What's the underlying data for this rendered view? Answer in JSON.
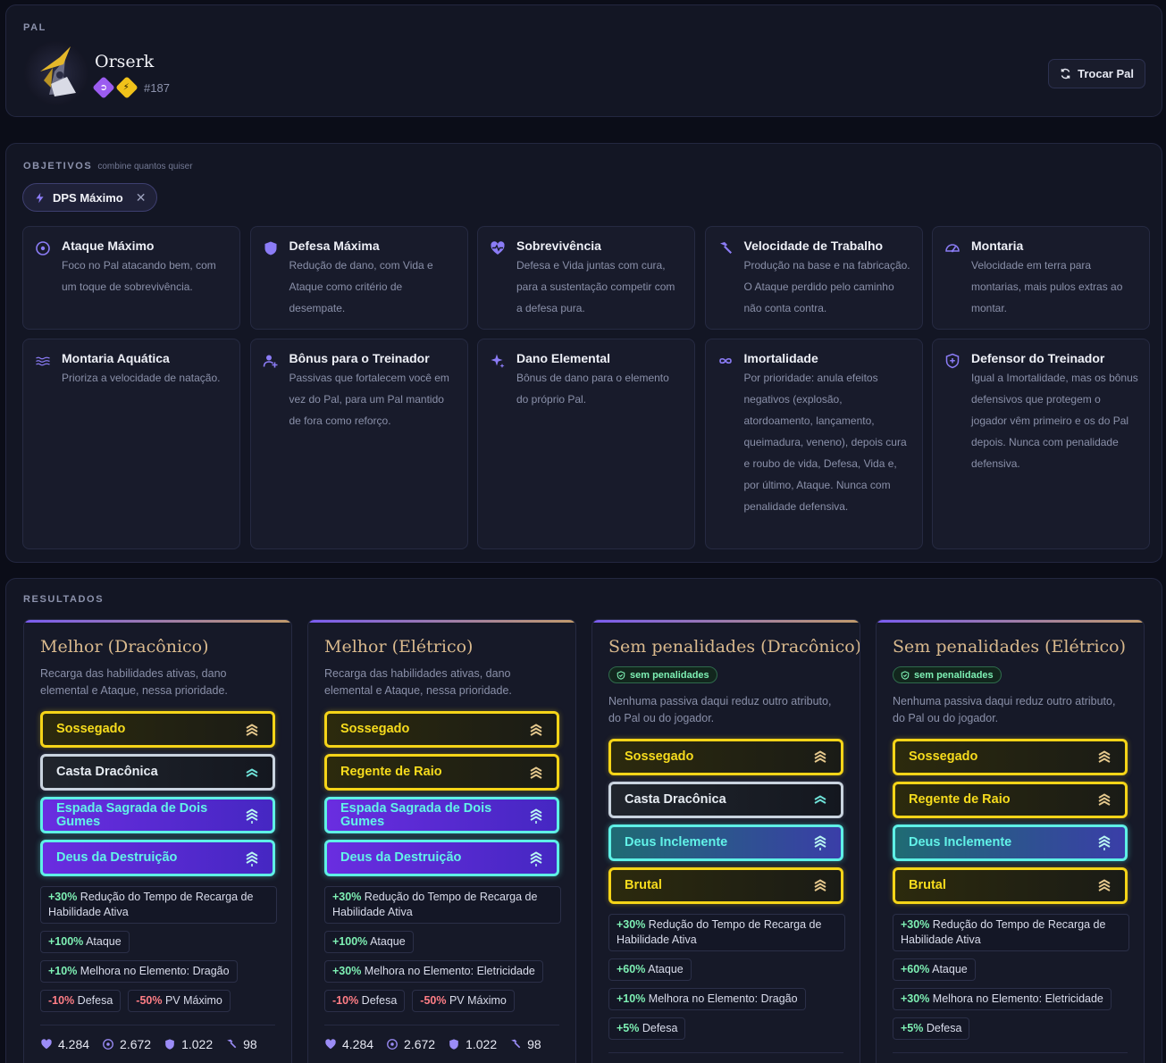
{
  "pal": {
    "section_label": "PAL",
    "name": "Orserk",
    "number": "#187",
    "swap_label": "Trocar Pal"
  },
  "objectives": {
    "section_label": "OBJETIVOS",
    "section_sub": "combine quantos quiser",
    "selected_chip": "DPS Máximo",
    "items": [
      {
        "title": "Ataque Máximo",
        "desc": "Foco no Pal atacando bem, com um toque de sobrevivência.",
        "icon": "target-icon"
      },
      {
        "title": "Defesa Máxima",
        "desc": "Redução de dano, com Vida e Ataque como critério de desempate.",
        "icon": "shield-icon"
      },
      {
        "title": "Sobrevivência",
        "desc": "Defesa e Vida juntas com cura, para a sustentação competir com a defesa pura.",
        "icon": "heart-pulse-icon"
      },
      {
        "title": "Velocidade de Trabalho",
        "desc": "Produção na base e na fabricação. O Ataque perdido pelo caminho não conta contra.",
        "icon": "hammer-icon"
      },
      {
        "title": "Montaria",
        "desc": "Velocidade em terra para montarias, mais pulos extras ao montar.",
        "icon": "gauge-icon"
      },
      {
        "title": "Montaria Aquática",
        "desc": "Prioriza a velocidade de natação.",
        "icon": "waves-icon"
      },
      {
        "title": "Bônus para o Treinador",
        "desc": "Passivas que fortalecem você em vez do Pal, para um Pal mantido de fora como reforço.",
        "icon": "user-plus-icon"
      },
      {
        "title": "Dano Elemental",
        "desc": "Bônus de dano para o elemento do próprio Pal.",
        "icon": "sparkles-icon"
      },
      {
        "title": "Imortalidade",
        "desc": "Por prioridade: anula efeitos negativos (explosão, atordoamento, lançamento, queimadura, veneno), depois cura e roubo de vida, Defesa, Vida e, por último, Ataque. Nunca com penalidade defensiva.",
        "icon": "infinity-icon"
      },
      {
        "title": "Defensor do Treinador",
        "desc": "Igual a Imortalidade, mas os bônus defensivos que protegem o jogador vêm primeiro e os do Pal depois. Nunca com penalidade defensiva.",
        "icon": "shield-plus-icon"
      }
    ]
  },
  "results": {
    "section_label": "RESULTADOS",
    "no_penalty_label": "sem penalidades",
    "cards": [
      {
        "title": "Melhor (Dracônico)",
        "no_penalty": false,
        "desc": "Recarga das habilidades ativas, dano elemental e Ataque, nessa prioridade.",
        "passives": [
          {
            "name": "Sossegado",
            "tier": "gold"
          },
          {
            "name": "Casta Dracônica",
            "tier": "silver"
          },
          {
            "name": "Espada Sagrada de Dois Gumes",
            "tier": "purple"
          },
          {
            "name": "Deus da Destruição",
            "tier": "purple"
          }
        ],
        "effects": [
          {
            "val": "+30%",
            "label": " Redução do Tempo de Recarga de Habilidade Ativa",
            "neg": false,
            "wide": true
          },
          {
            "val": "+100%",
            "label": " Ataque",
            "neg": false,
            "wide": false
          },
          {
            "val": "+10%",
            "label": " Melhora no Elemento: Dragão",
            "neg": false,
            "wide": false
          },
          {
            "val": "-10%",
            "label": " Defesa",
            "neg": true,
            "wide": false
          },
          {
            "val": "-50%",
            "label": " PV Máximo",
            "neg": true,
            "wide": false
          }
        ],
        "stats": {
          "hp": "4.284",
          "atk": "2.672",
          "def": "1.022",
          "work": "98"
        }
      },
      {
        "title": "Melhor (Elétrico)",
        "no_penalty": false,
        "desc": "Recarga das habilidades ativas, dano elemental e Ataque, nessa prioridade.",
        "passives": [
          {
            "name": "Sossegado",
            "tier": "gold"
          },
          {
            "name": "Regente de Raio",
            "tier": "gold"
          },
          {
            "name": "Espada Sagrada de Dois Gumes",
            "tier": "purple"
          },
          {
            "name": "Deus da Destruição",
            "tier": "purple"
          }
        ],
        "effects": [
          {
            "val": "+30%",
            "label": " Redução do Tempo de Recarga de Habilidade Ativa",
            "neg": false,
            "wide": true
          },
          {
            "val": "+100%",
            "label": " Ataque",
            "neg": false,
            "wide": false
          },
          {
            "val": "+30%",
            "label": " Melhora no Elemento: Eletricidade",
            "neg": false,
            "wide": false
          },
          {
            "val": "-10%",
            "label": " Defesa",
            "neg": true,
            "wide": false
          },
          {
            "val": "-50%",
            "label": " PV Máximo",
            "neg": true,
            "wide": false
          }
        ],
        "stats": {
          "hp": "4.284",
          "atk": "2.672",
          "def": "1.022",
          "work": "98"
        }
      },
      {
        "title": "Sem penalidades (Dracônico)",
        "no_penalty": true,
        "desc": "Nenhuma passiva daqui reduz outro atributo, do Pal ou do jogador.",
        "passives": [
          {
            "name": "Sossegado",
            "tier": "gold"
          },
          {
            "name": "Casta Dracônica",
            "tier": "silver"
          },
          {
            "name": "Deus Inclemente",
            "tier": "teal"
          },
          {
            "name": "Brutal",
            "tier": "gold"
          }
        ],
        "effects": [
          {
            "val": "+30%",
            "label": " Redução do Tempo de Recarga de Habilidade Ativa",
            "neg": false,
            "wide": true
          },
          {
            "val": "+60%",
            "label": " Ataque",
            "neg": false,
            "wide": false
          },
          {
            "val": "+10%",
            "label": " Melhora no Elemento: Dragão",
            "neg": false,
            "wide": false
          },
          {
            "val": "+5%",
            "label": " Defesa",
            "neg": false,
            "wide": false
          }
        ],
        "stats": {
          "hp": "",
          "atk": "",
          "def": "",
          "work": ""
        }
      },
      {
        "title": "Sem penalidades (Elétrico)",
        "no_penalty": true,
        "desc": "Nenhuma passiva daqui reduz outro atributo, do Pal ou do jogador.",
        "passives": [
          {
            "name": "Sossegado",
            "tier": "gold"
          },
          {
            "name": "Regente de Raio",
            "tier": "gold"
          },
          {
            "name": "Deus Inclemente",
            "tier": "teal"
          },
          {
            "name": "Brutal",
            "tier": "gold"
          }
        ],
        "effects": [
          {
            "val": "+30%",
            "label": " Redução do Tempo de Recarga de Habilidade Ativa",
            "neg": false,
            "wide": true
          },
          {
            "val": "+60%",
            "label": " Ataque",
            "neg": false,
            "wide": false
          },
          {
            "val": "+30%",
            "label": " Melhora no Elemento: Eletricidade",
            "neg": false,
            "wide": false
          },
          {
            "val": "+5%",
            "label": " Defesa",
            "neg": false,
            "wide": false
          }
        ],
        "stats": {
          "hp": "",
          "atk": "",
          "def": "",
          "work": ""
        }
      }
    ]
  },
  "colors": {
    "accent": "#8b7cf6",
    "gold": "#f5d418",
    "teal": "#5ef0e6",
    "positive": "#7ef0b4",
    "negative": "#ff7e86"
  }
}
